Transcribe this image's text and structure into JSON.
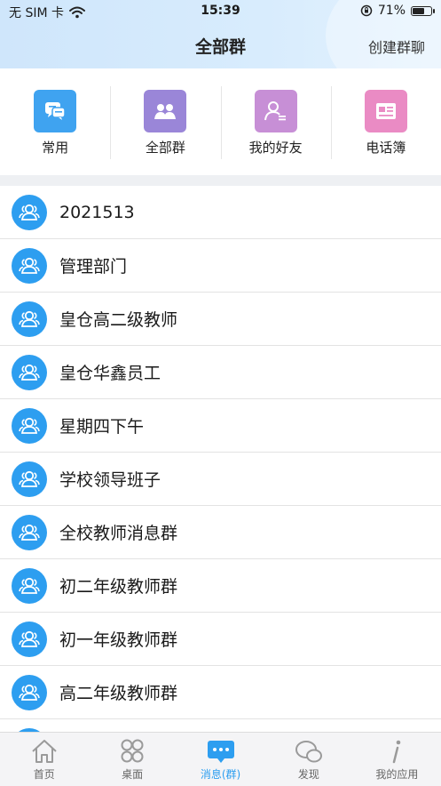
{
  "status_bar": {
    "carrier": "无 SIM 卡",
    "time": "15:39",
    "battery": "71%",
    "battery_level": 0.71
  },
  "nav": {
    "title": "全部群",
    "action": "创建群聊"
  },
  "quick_menu": [
    {
      "label": "常用",
      "icon": "chat-bubbles-icon",
      "color": "#3fa3f0"
    },
    {
      "label": "全部群",
      "icon": "group-icon",
      "color": "#9a86d8"
    },
    {
      "label": "我的好友",
      "icon": "friend-icon",
      "color": "#c78fd6"
    },
    {
      "label": "电话簿",
      "icon": "phonebook-icon",
      "color": "#ea8bc4"
    }
  ],
  "groups": [
    {
      "name": "2021513"
    },
    {
      "name": "管理部门"
    },
    {
      "name": "皇仓高二级教师"
    },
    {
      "name": "皇仓华鑫员工"
    },
    {
      "name": "星期四下午"
    },
    {
      "name": "学校领导班子"
    },
    {
      "name": "全校教师消息群"
    },
    {
      "name": "初二年级教师群"
    },
    {
      "name": "初一年级教师群"
    },
    {
      "name": "高二年级教师群"
    },
    {
      "name": ""
    }
  ],
  "tabs": [
    {
      "label": "首页",
      "icon": "home-icon"
    },
    {
      "label": "桌面",
      "icon": "desktop-grid-icon"
    },
    {
      "label": "消息(群)",
      "icon": "message-icon",
      "active": true
    },
    {
      "label": "发现",
      "icon": "discover-icon"
    },
    {
      "label": "我的应用",
      "icon": "info-icon"
    }
  ],
  "colors": {
    "accent": "#2d9ef0",
    "header_bg": "#d3e9fc"
  }
}
